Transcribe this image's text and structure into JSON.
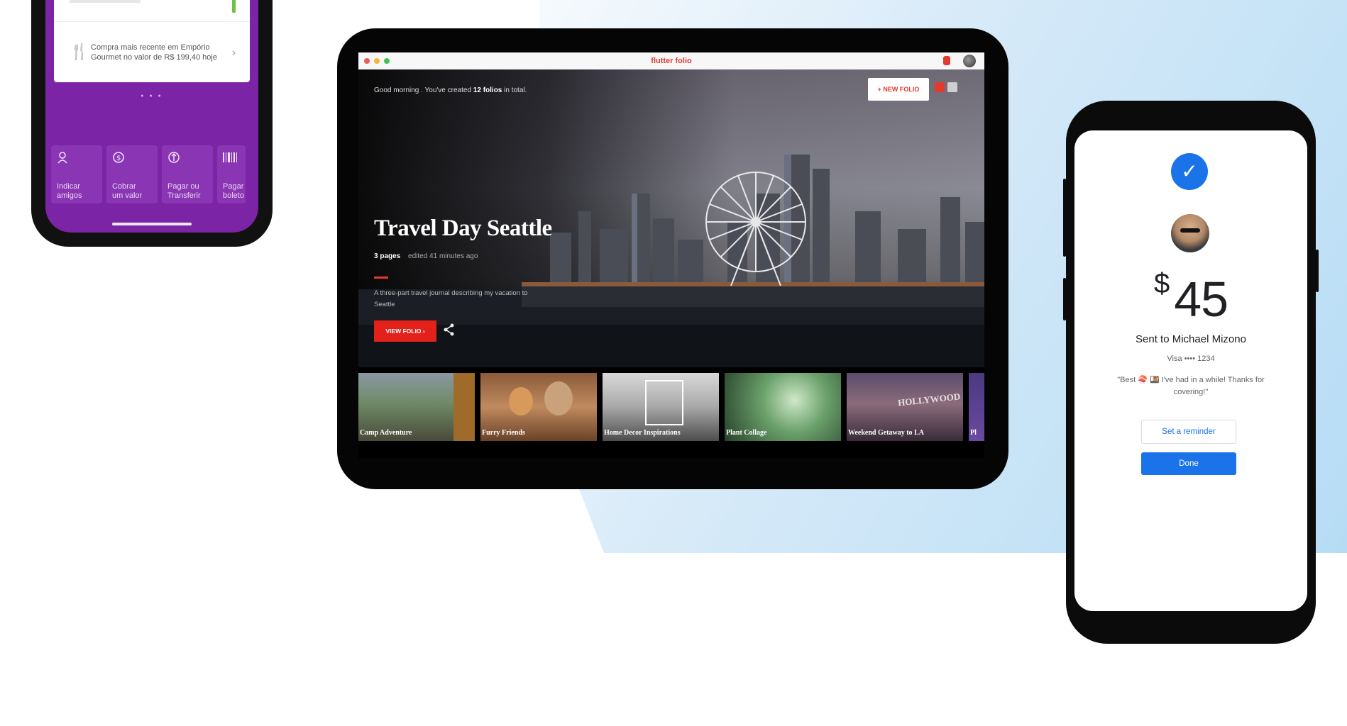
{
  "purple_app": {
    "recent_purchase": "Compra mais recente em Empório Gourmet no valor de R$ 199,40 hoje",
    "actions": [
      {
        "label": "Indicar\namigos",
        "icon": "person-icon"
      },
      {
        "label": "Cobrar\num valor",
        "icon": "coin-icon"
      },
      {
        "label": "Pagar ou\nTransferir",
        "icon": "transfer-icon"
      },
      {
        "label": "Pagar\nboleto",
        "icon": "barcode-icon"
      }
    ],
    "accent_color": "#7b24a6"
  },
  "folio_app": {
    "window_title": "flutter folio",
    "greeting_prefix": "Good morning . You've created",
    "greeting_count": "12 folios",
    "greeting_suffix": "in total.",
    "new_folio_label": "+ NEW FOLIO",
    "hero": {
      "title": "Travel Day Seattle",
      "pages": "3 pages",
      "edited": "edited 41 minutes ago",
      "description": "A three-part travel journal describing my vacation to Seattle",
      "view_button": "VIEW FOLIO  ›"
    },
    "thumbnails": [
      {
        "label": "Camp Adventure"
      },
      {
        "label": "Furry Friends"
      },
      {
        "label": "Home Decor Inspirations"
      },
      {
        "label": "Plant Collage"
      },
      {
        "label": "Weekend Getaway to LA"
      },
      {
        "label": "Pl"
      }
    ],
    "accent_color": "#e4201a"
  },
  "pay_app": {
    "currency": "$",
    "amount": "45",
    "sent_to": "Sent to Michael Mizono",
    "card": "Visa •••• 1234",
    "note": "\"Best 🍣 🍱 I've had in a while! Thanks for covering!\"",
    "reminder_label": "Set a reminder",
    "done_label": "Done",
    "accent_color": "#1a73e8"
  }
}
